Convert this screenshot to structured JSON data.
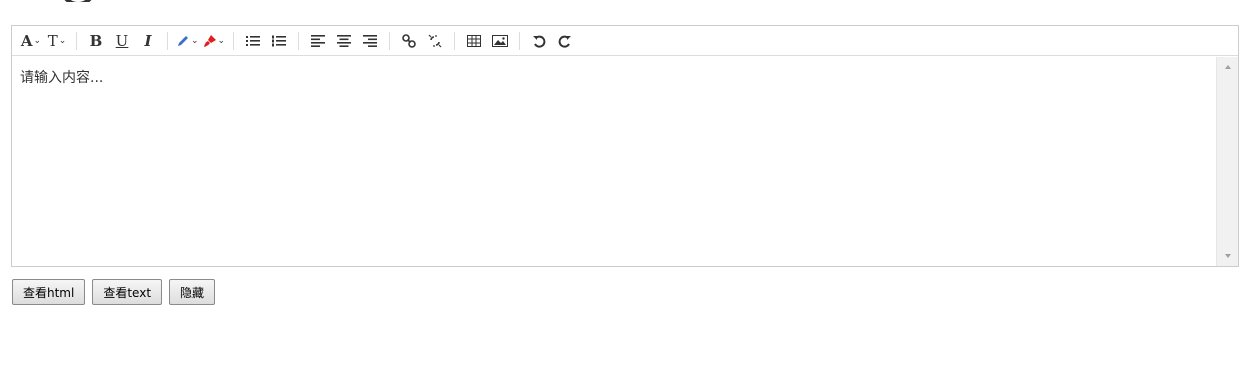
{
  "editor": {
    "placeholder": "请输入内容...",
    "toolbar": {
      "font_name_label": "A",
      "font_size_label": "T",
      "bold_label": "B",
      "underline_label": "U",
      "italic_label": "I",
      "forecolor_accent": "#3a6fc7",
      "backcolor_accent": "#e02020"
    }
  },
  "actions": {
    "view_html": "查看html",
    "view_text": "查看text",
    "hide": "隐藏"
  }
}
